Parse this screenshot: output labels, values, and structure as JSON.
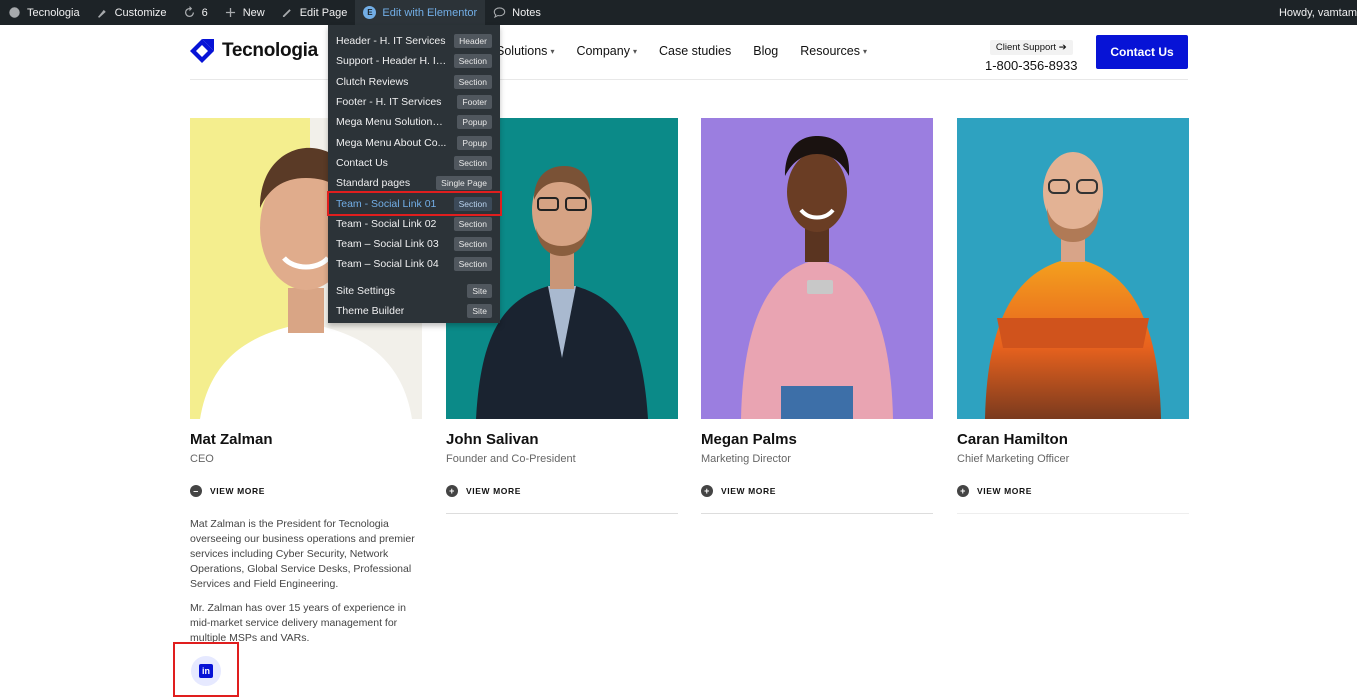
{
  "adminbar": {
    "site_name": "Tecnologia",
    "customize": "Customize",
    "updates_count": "6",
    "new": "New",
    "edit_page": "Edit Page",
    "edit_with_elementor": "Edit with Elementor",
    "notes": "Notes",
    "howdy": "Howdy, vamtam"
  },
  "elementor_menu": {
    "items": [
      {
        "label": "Header - H. IT Services",
        "tag": "Header"
      },
      {
        "label": "Support - Header H. IT Services",
        "tag": "Section"
      },
      {
        "label": "Clutch Reviews",
        "tag": "Section"
      },
      {
        "label": "Footer - H. IT Services",
        "tag": "Footer"
      },
      {
        "label": "Mega Menu Solutions ...",
        "tag": "Popup"
      },
      {
        "label": "Mega Menu About Co...",
        "tag": "Popup"
      },
      {
        "label": "Contact Us",
        "tag": "Section"
      },
      {
        "label": "Standard pages",
        "tag": "Single Page"
      },
      {
        "label": "Team - Social Link 01",
        "tag": "Section"
      },
      {
        "label": "Team - Social Link 02",
        "tag": "Section"
      },
      {
        "label": "Team – Social Link 03",
        "tag": "Section"
      },
      {
        "label": "Team – Social Link 04",
        "tag": "Section"
      }
    ],
    "site_settings": {
      "label": "Site Settings",
      "tag": "Site"
    },
    "theme_builder": {
      "label": "Theme Builder",
      "tag": "Site"
    }
  },
  "header": {
    "logo_text": "Tecnologia",
    "nav": [
      {
        "label": "Solutions",
        "has_caret": true
      },
      {
        "label": "Company",
        "has_caret": true
      },
      {
        "label": "Case studies",
        "has_caret": false
      },
      {
        "label": "Blog",
        "has_caret": false
      },
      {
        "label": "Resources",
        "has_caret": true
      }
    ],
    "support_badge": "Client Support ➔",
    "phone": "1-800-356-8933",
    "contact_button": "Contact Us"
  },
  "team": [
    {
      "name": "Mat Zalman",
      "role": "CEO",
      "view_more": "VIEW MORE",
      "expanded": true
    },
    {
      "name": "John Salivan",
      "role": "Founder and Co-President",
      "view_more": "VIEW MORE",
      "expanded": false
    },
    {
      "name": "Megan Palms",
      "role": "Marketing Director",
      "view_more": "VIEW MORE",
      "expanded": false
    },
    {
      "name": "Caran Hamilton",
      "role": "Chief Marketing Officer",
      "view_more": "VIEW MORE",
      "expanded": false
    }
  ],
  "bio": {
    "p1": "Mat Zalman is the President for Tecnologia overseeing our business operations and premier services including Cyber Security, Network Operations, Global Service Desks, Professional Services and Field Engineering.",
    "p2": "Mr. Zalman has over 15 years of experience in mid-market service delivery management for multiple MSPs and VARs."
  },
  "social": {
    "linkedin_icon": "linkedin-icon"
  },
  "colors": {
    "brand_blue": "#0713d6",
    "admin_bg": "#1d2327",
    "highlight_red": "#e01e1e"
  }
}
